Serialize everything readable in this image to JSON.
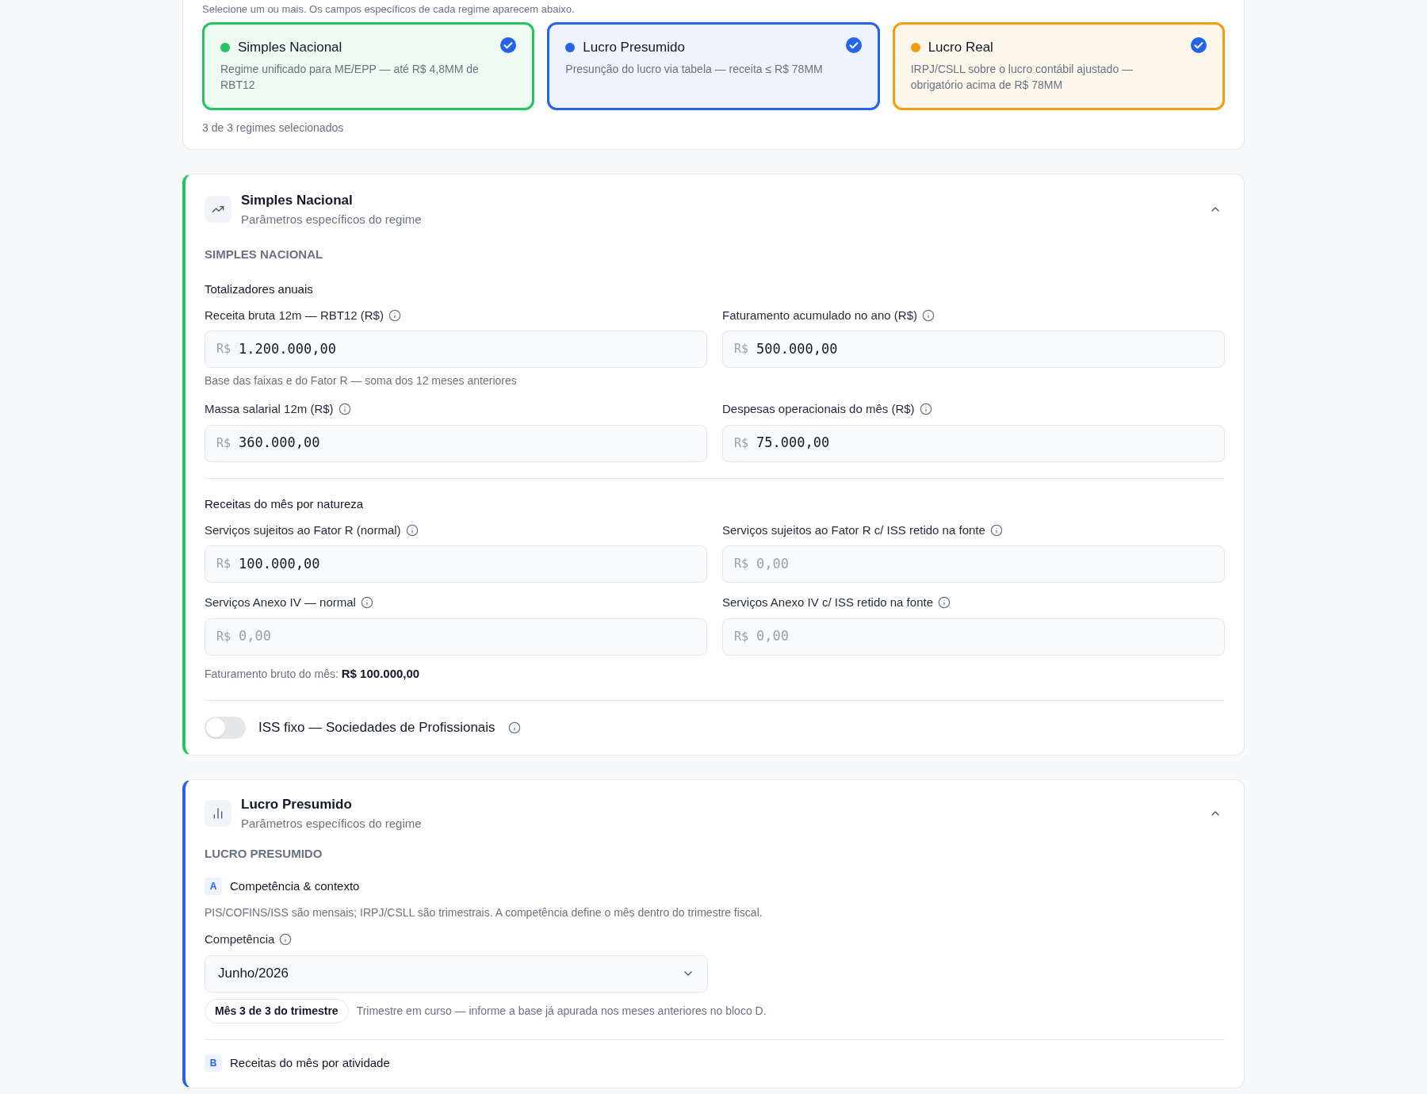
{
  "regime_picker": {
    "hint": "Selecione um ou mais. Os campos específicos de cada regime aparecem abaixo.",
    "options": [
      {
        "name": "Simples Nacional",
        "description": "Regime unificado para ME/EPP — até R$ 4,8MM de RBT12",
        "color": "#22c55e",
        "selected": true
      },
      {
        "name": "Lucro Presumido",
        "description": "Presunção do lucro via tabela — receita ≤ R$ 78MM",
        "color": "#2563eb",
        "selected": true
      },
      {
        "name": "Lucro Real",
        "description": "IRPJ/CSLL sobre o lucro contábil ajustado — obrigatório acima de R$ 78MM",
        "color": "#f59e0b",
        "selected": true
      }
    ],
    "count": "3 de 3 regimes selecionados"
  },
  "simples": {
    "title": "Simples Nacional",
    "subtitle": "Parâmetros específicos do regime",
    "expanded": true,
    "heading": "SIMPLES NACIONAL",
    "groups": [
      {
        "title": "Totalizadores anuais",
        "fields": [
          {
            "label": "Receita bruta 12m — RBT12 (R$)",
            "prefix": "R$",
            "value": "1.200.000,00",
            "help": "Base das faixas e do Fator R — soma dos 12 meses anteriores"
          },
          {
            "label": "Faturamento acumulado no ano (R$)",
            "prefix": "R$",
            "value": "500.000,00"
          },
          {
            "label": "Massa salarial 12m (R$)",
            "prefix": "R$",
            "value": "360.000,00"
          },
          {
            "label": "Despesas operacionais do mês (R$)",
            "prefix": "R$",
            "value": "75.000,00"
          }
        ]
      },
      {
        "title": "Receitas do mês por natureza",
        "fields": [
          {
            "label": "Serviços sujeitos ao Fator R (normal)",
            "prefix": "R$",
            "value": "100.000,00"
          },
          {
            "label": "Serviços sujeitos ao Fator R c/ ISS retido na fonte",
            "prefix": "R$",
            "placeholder": "0,00"
          },
          {
            "label": "Serviços Anexo IV — normal",
            "prefix": "R$",
            "placeholder": "0,00"
          },
          {
            "label": "Serviços Anexo IV c/ ISS retido na fonte",
            "prefix": "R$",
            "placeholder": "0,00"
          }
        ]
      }
    ],
    "total_label": "Faturamento bruto do mês:",
    "total_value": "R$ 100.000,00",
    "toggle": {
      "label": "ISS fixo — Sociedades de Profissionais",
      "on": false
    }
  },
  "presumido": {
    "title": "Lucro Presumido",
    "subtitle": "Parâmetros específicos do regime",
    "expanded": true,
    "heading": "LUCRO PRESUMIDO",
    "steps": [
      {
        "letter": "A",
        "title": "Competência & contexto",
        "note": "PIS/COFINS/ISS são mensais; IRPJ/CSLL são trimestrais. A competência define o mês dentro do trimestre fiscal.",
        "select_label": "Competência",
        "select_value": "Junho/2026",
        "badge": "Mês 3 de 3 do trimestre",
        "badge_note": "Trimestre em curso — informe a base já apurada nos meses anteriores no bloco D."
      },
      {
        "letter": "B",
        "title": "Receitas do mês por atividade"
      }
    ]
  }
}
